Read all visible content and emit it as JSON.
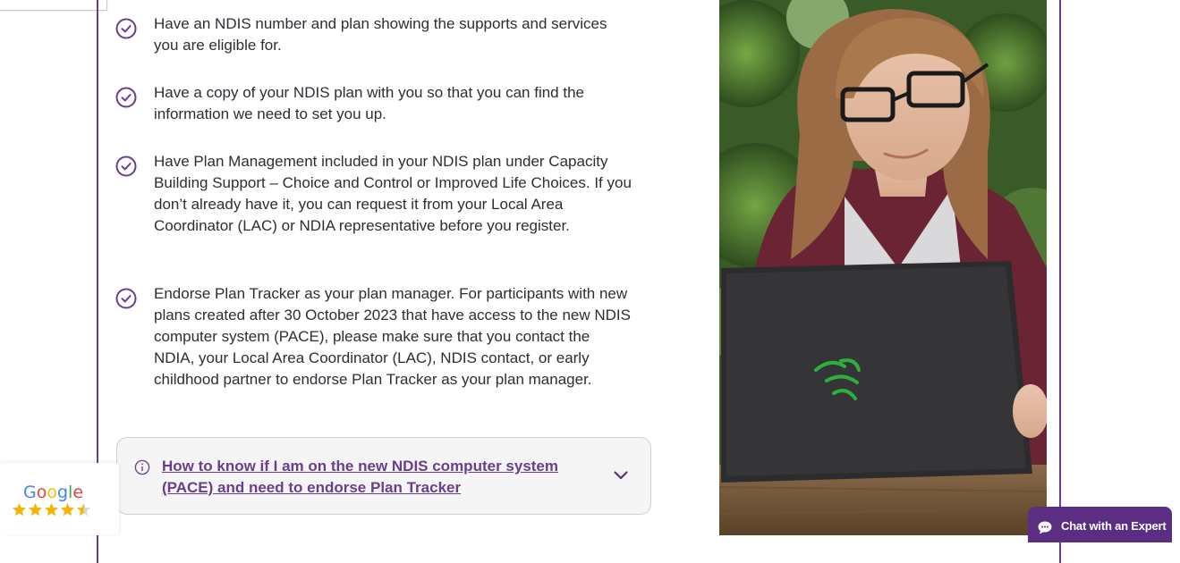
{
  "requirements": [
    {
      "text": "Have an NDIS number and plan showing the supports and services you are eligible for."
    },
    {
      "text": "Have a copy of your NDIS plan with you so that you can find the information we need to set you up."
    },
    {
      "text": "Have Plan Management included in your NDIS plan under Capacity Building Support – Choice and Control or Improved Life Choices. If you don’t already have it, you can request it from your Local Area Coordinator (LAC) or NDIA representative before you register."
    },
    {
      "text": "Endorse Plan Tracker as your plan manager. For participants with new plans created after 30 October 2023 that have access to the new NDIS computer system (PACE), please make sure that you contact the NDIA, your Local Area Coordinator (LAC), NDIS contact, or early childhood partner to endorse Plan Tracker as your plan manager."
    }
  ],
  "info_box": {
    "link_text": "How to know if I am on the new NDIS computer system (PACE) and need to endorse Plan Tracker",
    "icon": "info-circle-icon",
    "toggle_icon": "chevron-down-icon"
  },
  "google_badge": {
    "word": "Google",
    "rating_stars": 4.5,
    "letter_colors": [
      "#4285F4",
      "#EA4335",
      "#FBBC05",
      "#4285F4",
      "#34A853",
      "#EA4335"
    ]
  },
  "chat": {
    "label": "Chat with an Expert",
    "icon": "chat-bubble-icon"
  },
  "colors": {
    "accent": "#6a3d8f",
    "chat_bg": "#5b2e84",
    "star": "#f4b400"
  }
}
